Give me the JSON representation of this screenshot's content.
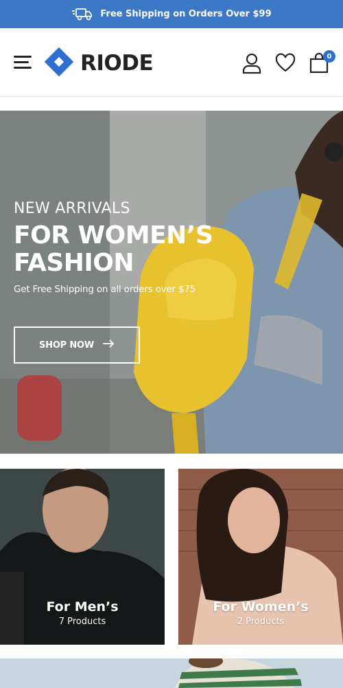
{
  "announcement": {
    "text": "Free Shipping on Orders Over $99",
    "icon": "truck-icon"
  },
  "header": {
    "logo_text": "RIODE",
    "menu_icon": "hamburger-menu-icon",
    "account_icon": "user-icon",
    "wishlist_icon": "heart-icon",
    "cart_icon": "shopping-bag-icon",
    "cart_count": "0"
  },
  "hero": {
    "eyebrow": "NEW ARRIVALS",
    "title": "FOR WOMEN’S FASHION",
    "subtitle": "Get Free Shipping on all orders over $75",
    "cta_label": "SHOP NOW",
    "cta_icon": "arrow-right-icon"
  },
  "categories": [
    {
      "title": "For Men’s",
      "count": "7 Products"
    },
    {
      "title": "For Women’s",
      "count": "2 Products"
    }
  ],
  "colors": {
    "accent": "#3d78c7",
    "badge": "#2f6fd2",
    "text": "#222222"
  }
}
